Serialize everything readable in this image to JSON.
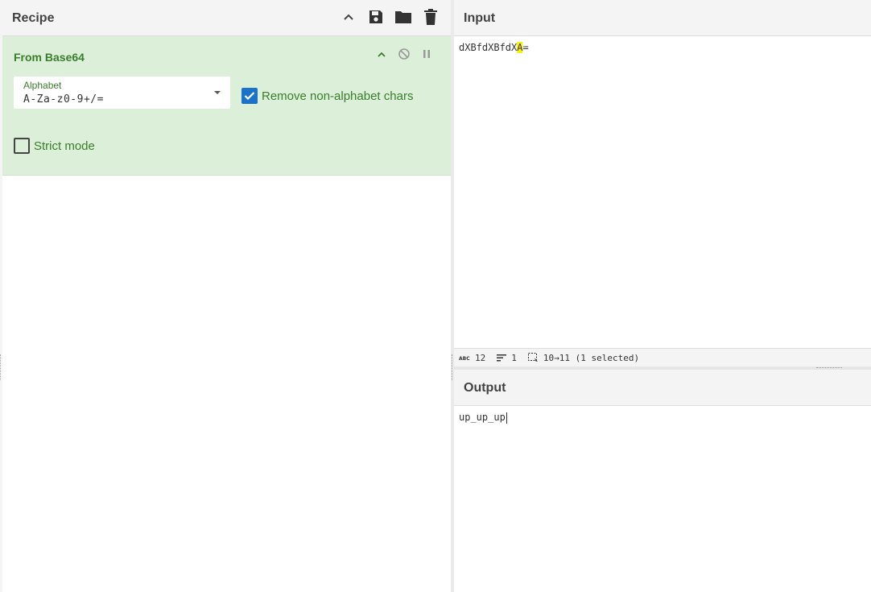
{
  "recipe": {
    "title": "Recipe",
    "header_icons": [
      "chevron-up-icon",
      "save-icon",
      "folder-icon",
      "trash-icon"
    ],
    "operation": {
      "name": "From Base64",
      "icons": [
        "chevron-up-icon",
        "disable-icon",
        "pause-icon"
      ],
      "alphabet_label": "Alphabet",
      "alphabet_value": "A-Za-z0-9+/=",
      "remove_label": "Remove non-alphabet chars",
      "remove_checked": true,
      "strict_label": "Strict mode",
      "strict_checked": false
    },
    "colors": {
      "operation_bg": "#dcefd9",
      "operation_text": "#3a7d2c",
      "checkbox_blue": "#1a73c8"
    }
  },
  "input": {
    "title": "Input",
    "text_before": "dXBfdXBfdX",
    "text_selected": "A",
    "text_after": "=",
    "status": {
      "length": "12",
      "lines": "1",
      "selection": "10→11 (1 selected)"
    }
  },
  "output": {
    "title": "Output",
    "text": "up_up_up"
  }
}
